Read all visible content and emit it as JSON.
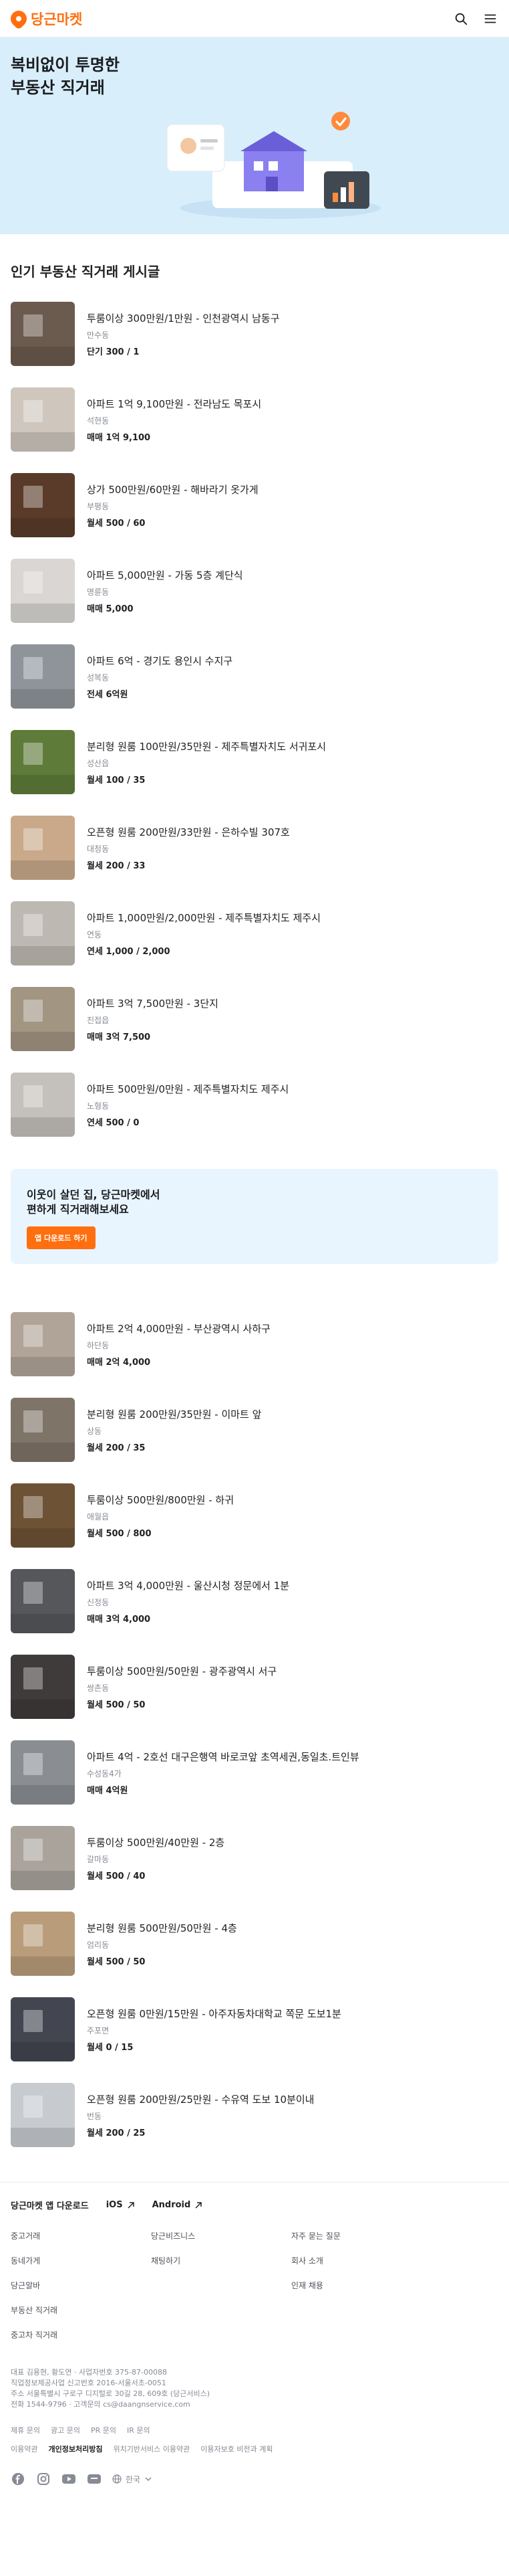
{
  "header": {
    "logo_text": "당근마켓",
    "brand_color": "#ff6f0f",
    "search_icon": "search-icon",
    "menu_icon": "hamburger-menu-icon"
  },
  "hero": {
    "title_line1": "복비없이 투명한",
    "title_line2": "부동산 직거래"
  },
  "section": {
    "title": "인기 부동산 직거래 게시글"
  },
  "listings_a": [
    {
      "title": "투룸이상 300만원/1만원 - 인천광역시 남동구",
      "region": "만수동",
      "price": "단기 300 / 1",
      "color": "#6b5a4e"
    },
    {
      "title": "아파트 1억 9,100만원 - 전라남도 목포시",
      "region": "석현동",
      "price": "매매 1억 9,100",
      "color": "#cfc7bd"
    },
    {
      "title": "상가 500만원/60만원 - 해바라기 옷가게",
      "region": "부평동",
      "price": "월세 500 / 60",
      "color": "#5a3b2a"
    },
    {
      "title": "아파트 5,000만원 - 가동 5층 계단식",
      "region": "명륜동",
      "price": "매매 5,000",
      "color": "#d9d6d3"
    },
    {
      "title": "아파트 6억 - 경기도 용인시 수지구",
      "region": "성복동",
      "price": "전세 6억원",
      "color": "#8f949a"
    },
    {
      "title": "분리형 원룸 100만원/35만원 - 제주특별자치도 서귀포시",
      "region": "성산읍",
      "price": "월세 100 / 35",
      "color": "#5e7b3a"
    },
    {
      "title": "오픈형 원룸 200만원/33만원 - 은하수빌 307호",
      "region": "대청동",
      "price": "월세 200 / 33",
      "color": "#c9a98a"
    },
    {
      "title": "아파트 1,000만원/2,000만원 - 제주특별자치도 제주시",
      "region": "연동",
      "price": "연세 1,000 / 2,000",
      "color": "#bdb9b2"
    },
    {
      "title": "아파트 3억 7,500만원 - 3단지",
      "region": "진접읍",
      "price": "매매 3억 7,500",
      "color": "#a29683"
    },
    {
      "title": "아파트 500만원/0만원 - 제주특별자치도 제주시",
      "region": "노형동",
      "price": "연세 500 / 0",
      "color": "#c4c1bc"
    }
  ],
  "banner": {
    "line1": "이웃이 살던 집, 당근마켓에서",
    "line2": "편하게 직거래해보세요",
    "button": "앱 다운로드 하기"
  },
  "listings_b": [
    {
      "title": "아파트 2억 4,000만원 - 부산광역시 사하구",
      "region": "하단동",
      "price": "매매 2억 4,000",
      "color": "#b0a499"
    },
    {
      "title": "분리형 원룸 200만원/35만원 - 이마트 앞",
      "region": "상동",
      "price": "월세 200 / 35",
      "color": "#7f7468"
    },
    {
      "title": "투룸이상 500만원/800만원 - 하귀",
      "region": "애월읍",
      "price": "월세 500 / 800",
      "color": "#6e5236"
    },
    {
      "title": "아파트 3억 4,000만원 - 울산시청 정문에서 1분",
      "region": "신정동",
      "price": "매매 3억 4,000",
      "color": "#55575b"
    },
    {
      "title": "투룸이상 500만원/50만원 - 광주광역시 서구",
      "region": "쌍촌동",
      "price": "월세 500 / 50",
      "color": "#3e3b3a"
    },
    {
      "title": "아파트 4억 - 2호선 대구은행역 바로코앞 초역세권,동일초.트인뷰",
      "region": "수성동4가",
      "price": "매매 4억원",
      "color": "#8a8e93"
    },
    {
      "title": "투룸이상 500만원/40만원 - 2층",
      "region": "갈마동",
      "price": "월세 500 / 40",
      "color": "#a9a39b"
    },
    {
      "title": "분리형 원룸 500만원/50만원 - 4층",
      "region": "엄리동",
      "price": "월세 500 / 50",
      "color": "#b99d7b"
    },
    {
      "title": "오픈형 원룸 0만원/15만원 - 아주자동차대학교 쪽문 도보1분",
      "region": "주포면",
      "price": "월세 0 / 15",
      "color": "#434650"
    },
    {
      "title": "오픈형 원룸 200만원/25만원 - 수유역 도보 10분이내",
      "region": "번동",
      "price": "월세 200 / 25",
      "color": "#c7cbd0"
    }
  ],
  "footer": {
    "app_download": "당근마켓 앱 다운로드",
    "ios": "iOS",
    "android": "Android",
    "links": [
      "중고거래",
      "당근비즈니스",
      "자주 묻는 질문",
      "동네가게",
      "채팅하기",
      "회사 소개",
      "당근알바",
      "",
      "인재 채용",
      "부동산 직거래",
      "",
      "",
      "중고차 직거래",
      "",
      ""
    ],
    "company_line1": "대표 김용현, 황도연 · 사업자번호 375-87-00088",
    "company_line2": "직업정보제공사업 신고번호 2016-서울서초-0051",
    "company_line3": "주소 서울특별시 구로구 디지털로 30길 28, 609호 (당근서비스)",
    "company_line4": "전화 1544-9796 · 고객문의 cs@daangnservice.com",
    "policy1": [
      "제휴 문의",
      "광고 문의",
      "PR 문의",
      "IR 문의"
    ],
    "policy2_bold": "개인정보처리방침",
    "policy2": [
      "이용약관",
      "위치기반서비스 이용약관",
      "이용자보호 비전과 계획"
    ],
    "language": "한국"
  }
}
